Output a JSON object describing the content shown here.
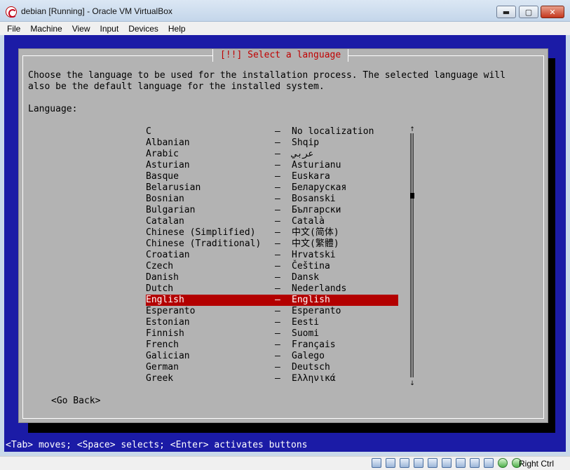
{
  "window": {
    "title": "debian [Running] - Oracle VM VirtualBox",
    "min_label": "▬",
    "max_label": "▢",
    "close_label": "✕"
  },
  "menu": [
    "File",
    "Machine",
    "View",
    "Input",
    "Devices",
    "Help"
  ],
  "dialog": {
    "title": "[!!] Select a language",
    "description": "Choose the language to be used for the installation process. The selected language will\nalso be the default language for the installed system.",
    "list_label": "Language:",
    "separator": "–",
    "selected_index": 14,
    "languages": [
      {
        "name": "C",
        "native": "No localization"
      },
      {
        "name": "Albanian",
        "native": "Shqip"
      },
      {
        "name": "Arabic",
        "native": "عربي"
      },
      {
        "name": "Asturian",
        "native": "Asturianu"
      },
      {
        "name": "Basque",
        "native": "Euskara"
      },
      {
        "name": "Belarusian",
        "native": "Беларуская"
      },
      {
        "name": "Bosnian",
        "native": "Bosanski"
      },
      {
        "name": "Bulgarian",
        "native": "Български"
      },
      {
        "name": "Catalan",
        "native": "Català"
      },
      {
        "name": "Chinese (Simplified)",
        "native": "中文(简体)"
      },
      {
        "name": "Chinese (Traditional)",
        "native": "中文(繁體)"
      },
      {
        "name": "Croatian",
        "native": "Hrvatski"
      },
      {
        "name": "Czech",
        "native": "Čeština"
      },
      {
        "name": "Danish",
        "native": "Dansk"
      },
      {
        "name": "Dutch",
        "native": "Nederlands"
      },
      {
        "name": "English",
        "native": "English"
      },
      {
        "name": "Esperanto",
        "native": "Esperanto"
      },
      {
        "name": "Estonian",
        "native": "Eesti"
      },
      {
        "name": "Finnish",
        "native": "Suomi"
      },
      {
        "name": "French",
        "native": "Français"
      },
      {
        "name": "Galician",
        "native": "Galego"
      },
      {
        "name": "German",
        "native": "Deutsch"
      },
      {
        "name": "Greek",
        "native": "Ελληνικά"
      }
    ],
    "scroll_up": "↑",
    "scroll_down": "↓",
    "go_back_label": "<Go Back>"
  },
  "status_line": "<Tab> moves; <Space> selects; <Enter> activates buttons",
  "host_bar": {
    "icons": [
      "hard-disk-icon",
      "optical-drive-icon",
      "audio-icon",
      "network-icon",
      "usb-icon",
      "shared-folders-icon",
      "display-icon",
      "video-capture-icon",
      "capture-icon",
      "mouse-integration-icon",
      "host-key-icon"
    ],
    "host_key_label": "Right Ctrl"
  }
}
